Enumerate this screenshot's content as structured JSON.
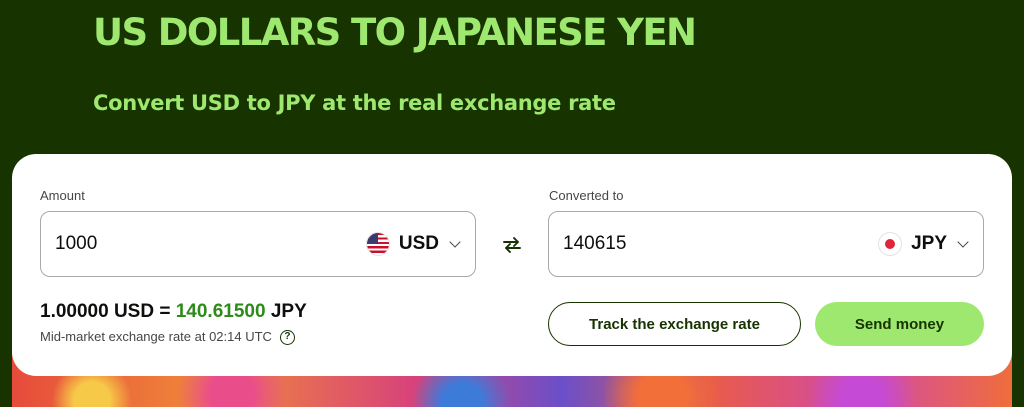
{
  "header": {
    "title": "US DOLLARS TO JAPANESE YEN",
    "subtitle": "Convert USD to JPY at the real exchange rate"
  },
  "converter": {
    "amount": {
      "label": "Amount",
      "value": "1000",
      "currency": "USD",
      "flag_icon": "us-flag-icon"
    },
    "converted": {
      "label": "Converted to",
      "value": "140615",
      "currency": "JPY",
      "flag_icon": "japan-flag-icon"
    },
    "swap_icon": "swap-arrows-icon",
    "rate": {
      "base": "1.00000 USD =",
      "value": "140.61500",
      "quote": "JPY",
      "note": "Mid-market exchange rate at 02:14 UTC"
    },
    "buttons": {
      "track": "Track the exchange rate",
      "send": "Send money"
    }
  },
  "colors": {
    "background": "#163300",
    "accent": "#9fe870",
    "rate_highlight": "#2f8a1c"
  }
}
